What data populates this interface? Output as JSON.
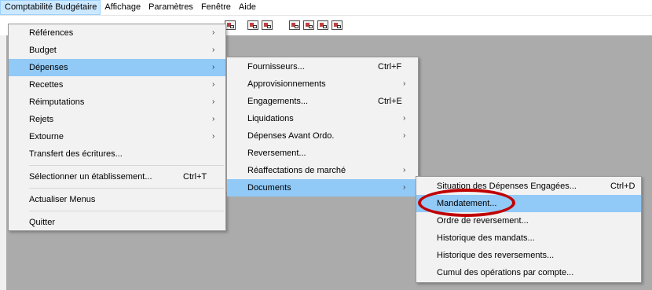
{
  "menubar": {
    "items": [
      {
        "label": "Comptabilité Budgétaire"
      },
      {
        "label": "Affichage"
      },
      {
        "label": "Paramètres"
      },
      {
        "label": "Fenêtre"
      },
      {
        "label": "Aide"
      }
    ]
  },
  "menu1": {
    "items": [
      {
        "label": "Références",
        "arrow": "›"
      },
      {
        "label": "Budget",
        "arrow": "›"
      },
      {
        "label": "Dépenses",
        "arrow": "›"
      },
      {
        "label": "Recettes",
        "arrow": "›"
      },
      {
        "label": "Réimputations",
        "arrow": "›"
      },
      {
        "label": "Rejets",
        "arrow": "›"
      },
      {
        "label": "Extourne",
        "arrow": "›"
      },
      {
        "label": "Transfert des écritures..."
      },
      {
        "label": "Sélectionner un établissement...",
        "shortcut": "Ctrl+T"
      },
      {
        "label": "Actualiser Menus"
      },
      {
        "label": "Quitter"
      }
    ]
  },
  "menu2": {
    "items": [
      {
        "label": "Fournisseurs...",
        "shortcut": "Ctrl+F"
      },
      {
        "label": "Approvisionnements",
        "arrow": "›"
      },
      {
        "label": "Engagements...",
        "shortcut": "Ctrl+E"
      },
      {
        "label": "Liquidations",
        "arrow": "›"
      },
      {
        "label": "Dépenses Avant Ordo.",
        "arrow": "›"
      },
      {
        "label": "Reversement..."
      },
      {
        "label": "Réaffectations de marché",
        "arrow": "›"
      },
      {
        "label": "Documents",
        "arrow": "›"
      }
    ]
  },
  "menu3": {
    "items": [
      {
        "label": "Situation des Dépenses Engagées...",
        "shortcut": "Ctrl+D"
      },
      {
        "label": "Mandatement..."
      },
      {
        "label": "Ordre de reversement..."
      },
      {
        "label": "Historique des mandats..."
      },
      {
        "label": "Historique des reversements..."
      },
      {
        "label": "Cumul des opérations par compte..."
      }
    ]
  },
  "colors": {
    "menu_highlight": "#91c9f7",
    "menubar_active": "#cce8ff",
    "annotation": "#c00000",
    "client_background": "#ababab"
  }
}
